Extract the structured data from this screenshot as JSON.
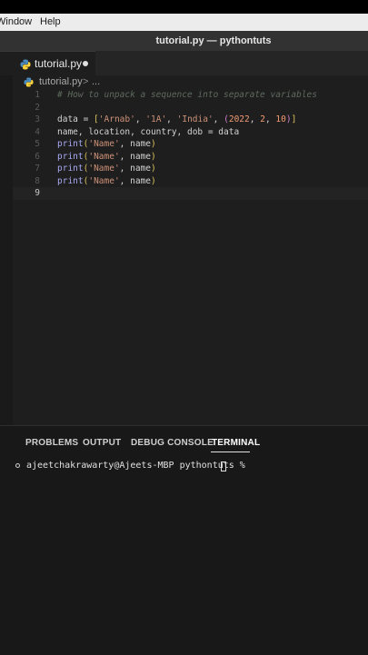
{
  "menu": {
    "items": [
      "Window",
      "Help"
    ]
  },
  "window": {
    "title": "tutorial.py — pythontuts"
  },
  "tab": {
    "filename": "tutorial.py",
    "modified": true
  },
  "breadcrumb": {
    "file": "tutorial.py",
    "separator": ">",
    "more": "..."
  },
  "editor": {
    "active_line": 9,
    "lines": [
      {
        "num": "1",
        "segments": [
          {
            "cls": "c-comment",
            "text": "# How to unpack a sequence into separate variables"
          }
        ]
      },
      {
        "num": "2",
        "segments": []
      },
      {
        "num": "3",
        "segments": [
          {
            "cls": "",
            "text": "data = "
          },
          {
            "cls": "c-br1",
            "text": "["
          },
          {
            "cls": "c-str",
            "text": "'Arnab'"
          },
          {
            "cls": "",
            "text": ", "
          },
          {
            "cls": "c-str",
            "text": "'1A'"
          },
          {
            "cls": "",
            "text": ", "
          },
          {
            "cls": "c-str",
            "text": "'India'"
          },
          {
            "cls": "",
            "text": ", "
          },
          {
            "cls": "c-br2",
            "text": "("
          },
          {
            "cls": "c-num",
            "text": "2022"
          },
          {
            "cls": "",
            "text": ", "
          },
          {
            "cls": "c-num",
            "text": "2"
          },
          {
            "cls": "",
            "text": ", "
          },
          {
            "cls": "c-num",
            "text": "10"
          },
          {
            "cls": "c-br2",
            "text": ")"
          },
          {
            "cls": "c-br1",
            "text": "]"
          }
        ]
      },
      {
        "num": "4",
        "segments": [
          {
            "cls": "",
            "text": "name, location, country, dob = data"
          }
        ]
      },
      {
        "num": "5",
        "segments": [
          {
            "cls": "c-func",
            "text": "print"
          },
          {
            "cls": "c-br1",
            "text": "("
          },
          {
            "cls": "c-str",
            "text": "'Name'"
          },
          {
            "cls": "",
            "text": ", name"
          },
          {
            "cls": "c-br1",
            "text": ")"
          }
        ]
      },
      {
        "num": "6",
        "segments": [
          {
            "cls": "c-func",
            "text": "print"
          },
          {
            "cls": "c-br1",
            "text": "("
          },
          {
            "cls": "c-str",
            "text": "'Name'"
          },
          {
            "cls": "",
            "text": ", name"
          },
          {
            "cls": "c-br1",
            "text": ")"
          }
        ]
      },
      {
        "num": "7",
        "segments": [
          {
            "cls": "c-func",
            "text": "print"
          },
          {
            "cls": "c-br1",
            "text": "("
          },
          {
            "cls": "c-str",
            "text": "'Name'"
          },
          {
            "cls": "",
            "text": ", name"
          },
          {
            "cls": "c-br1",
            "text": ")"
          }
        ]
      },
      {
        "num": "8",
        "segments": [
          {
            "cls": "c-func",
            "text": "print"
          },
          {
            "cls": "c-br1",
            "text": "("
          },
          {
            "cls": "c-str",
            "text": "'Name'"
          },
          {
            "cls": "",
            "text": ", name"
          },
          {
            "cls": "c-br1",
            "text": ")"
          }
        ]
      },
      {
        "num": "9",
        "segments": []
      }
    ]
  },
  "panel": {
    "tabs": [
      {
        "label": "PROBLEMS",
        "active": false
      },
      {
        "label": "OUTPUT",
        "active": false
      },
      {
        "label": "DEBUG CONSOLE",
        "active": false
      },
      {
        "label": "TERMINAL",
        "active": true
      }
    ]
  },
  "terminal": {
    "prompt": "ajeetchakrawarty@Ajeets-MBP pythontuts % "
  },
  "colors": {
    "editor_bg": "#1e1e1e",
    "panel_bg": "#181818",
    "string": "#ce9178",
    "number": "#f29b72",
    "function": "#a7a9f2"
  },
  "icons": {
    "file": "python-icon"
  }
}
